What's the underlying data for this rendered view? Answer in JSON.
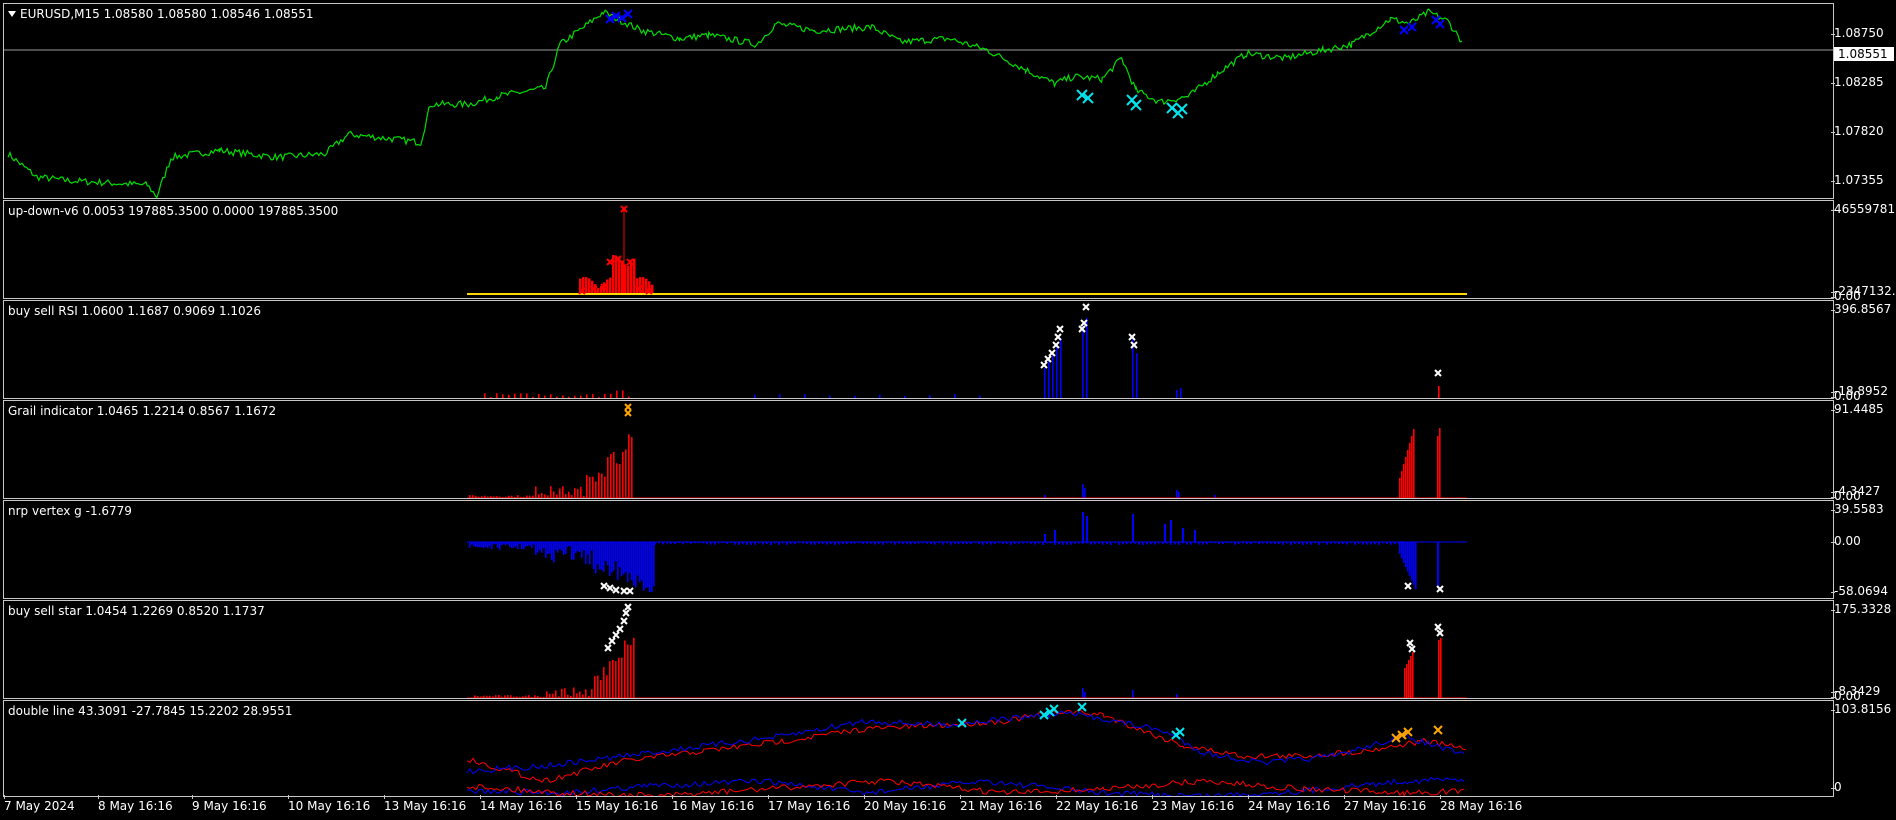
{
  "colors": {
    "background": "#000000",
    "price_line": "#00dd00",
    "bull": "#0000ff",
    "bear": "#ff0000",
    "yellow": "#ffd700",
    "cross_cyan": "#00e5ee",
    "cross_white": "#ffffff",
    "cross_orange": "#ffa500"
  },
  "main": {
    "symbol_menu_icon": "triangle-down-icon",
    "title": "EURUSD,M15  1.08580 1.08580 1.08546 1.08551",
    "current_price_label": "1.08551",
    "price_ticks": [
      "1.08750",
      "1.08285",
      "1.07820",
      "1.07355"
    ]
  },
  "indicators": [
    {
      "title": "up-down-v6 0.0053 197885.3500 0.0000 197885.3500",
      "ticks": [
        "46559781.",
        "-2347132.4",
        "0.00"
      ]
    },
    {
      "title": "buy sell RSI 1.0600 1.1687 0.9069 1.1026",
      "ticks": [
        "396.8567",
        "-18.8952",
        "0.00"
      ]
    },
    {
      "title": "Grail indicator 1.0465 1.2214 0.8567 1.1672",
      "ticks": [
        "91.4485",
        "-4.3427",
        "0.00"
      ]
    },
    {
      "title": "nrp vertex g -1.6779",
      "ticks": [
        "39.5583",
        "0.00",
        "-58.0694"
      ]
    },
    {
      "title": "buy sell star 1.0454 1.2269 0.8520 1.1737",
      "ticks": [
        "175.3328",
        "-8.3429",
        "0.00"
      ]
    },
    {
      "title": "double line 43.3091 -27.7845 15.2202 28.9551",
      "ticks": [
        "103.8156",
        "0"
      ]
    }
  ],
  "time_axis": [
    "7 May 2024",
    "8 May 16:16",
    "9 May 16:16",
    "10 May 16:16",
    "13 May 16:16",
    "14 May 16:16",
    "15 May 16:16",
    "16 May 16:16",
    "17 May 16:16",
    "20 May 16:16",
    "21 May 16:16",
    "22 May 16:16",
    "23 May 16:16",
    "24 May 16:16",
    "27 May 16:16",
    "28 May 16:16"
  ],
  "chart_data": [
    {
      "type": "line",
      "title": "EURUSD,M15  1.08580 1.08580 1.08546 1.08551",
      "x": [
        "7 May 2024",
        "8 May 16:16",
        "9 May 16:16",
        "10 May 16:16",
        "13 May 16:16",
        "14 May 16:16",
        "15 May 16:16",
        "16 May 16:16",
        "17 May 16:16",
        "20 May 16:16",
        "21 May 16:16",
        "22 May 16:16",
        "23 May 16:16",
        "24 May 16:16",
        "27 May 16:16",
        "28 May 16:16"
      ],
      "values": [
        1.076,
        1.0738,
        1.0742,
        1.0778,
        1.0784,
        1.0828,
        1.086,
        1.087,
        1.0865,
        1.087,
        1.0868,
        1.0828,
        1.0815,
        1.0848,
        1.0856,
        1.086
      ],
      "ylim": [
        1.0725,
        1.0895
      ],
      "yticks": [
        1.0875,
        1.08285,
        1.0782,
        1.07355
      ]
    }
  ]
}
